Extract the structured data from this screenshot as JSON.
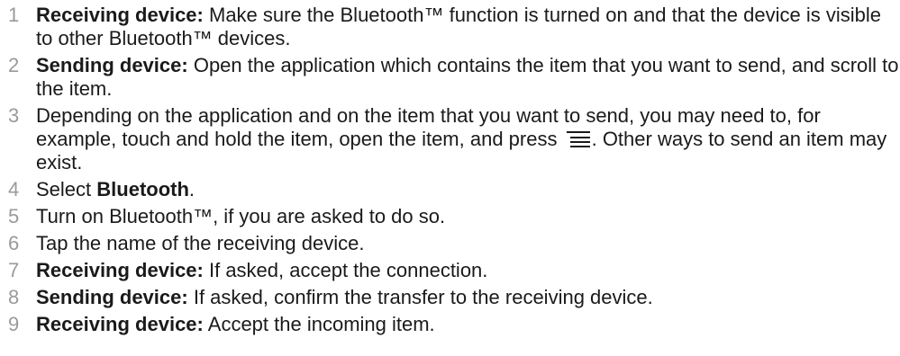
{
  "steps": [
    {
      "num": "1",
      "lead": "Receiving device:",
      "text": " Make sure the Bluetooth™ function is turned on and that the device is visible to other Bluetooth™ devices."
    },
    {
      "num": "2",
      "lead": "Sending device:",
      "text": " Open the application which contains the item that you want to send, and scroll to the item."
    },
    {
      "num": "3",
      "lead": "",
      "text": "Depending on the application and on the item that you want to send, you may need to, for example, touch and hold the item, open the item, and press",
      "text_after": ". Other ways to send an item may exist.",
      "icon": "menu-icon"
    },
    {
      "num": "4",
      "lead": "",
      "text": "Select ",
      "bold_word": "Bluetooth",
      "text_after": "."
    },
    {
      "num": "5",
      "lead": "",
      "text": "Turn on Bluetooth™, if you are asked to do so."
    },
    {
      "num": "6",
      "lead": "",
      "text": "Tap the name of the receiving device."
    },
    {
      "num": "7",
      "lead": "Receiving device:",
      "text": " If asked, accept the connection."
    },
    {
      "num": "8",
      "lead": "Sending device:",
      "text": " If asked, confirm the transfer to the receiving device."
    },
    {
      "num": "9",
      "lead": "Receiving device:",
      "text": " Accept the incoming item."
    }
  ]
}
